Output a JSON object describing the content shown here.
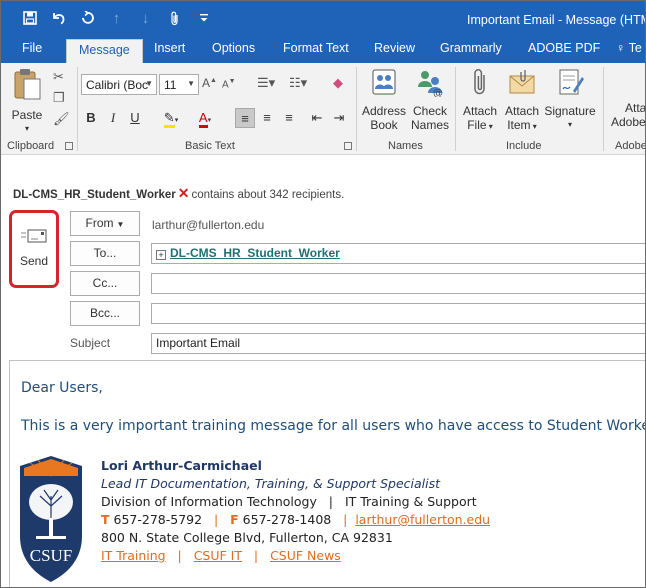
{
  "window": {
    "title": "Important Email - Message (HTM",
    "quick_access": [
      "save-icon",
      "undo-icon",
      "redo-icon",
      "up-arrow-icon",
      "down-arrow-icon",
      "attach-icon",
      "customize-icon"
    ]
  },
  "tabs": [
    {
      "label": "File",
      "active": false
    },
    {
      "label": "Message",
      "active": true
    },
    {
      "label": "Insert",
      "active": false
    },
    {
      "label": "Options",
      "active": false
    },
    {
      "label": "Format Text",
      "active": false
    },
    {
      "label": "Review",
      "active": false
    },
    {
      "label": "Grammarly",
      "active": false
    },
    {
      "label": "ADOBE PDF",
      "active": false
    },
    {
      "label": "Te",
      "active": false
    }
  ],
  "ribbon": {
    "clipboard": {
      "label": "Clipboard",
      "paste": "Paste"
    },
    "basic_text": {
      "label": "Basic Text",
      "font_name": "Calibri (Boc",
      "font_size": "11"
    },
    "names": {
      "label": "Names",
      "address_book": [
        "Address",
        "Book"
      ],
      "check_names": [
        "Check",
        "Names"
      ]
    },
    "include": {
      "label": "Include",
      "attach_file": [
        "Attach",
        "File"
      ],
      "attach_item": [
        "Attach",
        "Item"
      ],
      "signature": [
        "Signature",
        ""
      ]
    },
    "adobe": {
      "label": "Adobe",
      "attach": [
        "Atta",
        "Adobe"
      ]
    }
  },
  "info_bar": {
    "list_name": "DL-CMS_HR_Student_Worker",
    "message": "contains about 342 recipients."
  },
  "send": {
    "label": "Send"
  },
  "header": {
    "from_button": "From",
    "from_value": "larthur@fullerton.edu",
    "to_button": "To...",
    "to_value": "DL-CMS_HR_Student_Worker",
    "cc_button": "Cc...",
    "cc_value": "",
    "bcc_button": "Bcc...",
    "bcc_value": "",
    "subject_label": "Subject",
    "subject_value": "Important Email"
  },
  "body": {
    "greeting": "Dear Users,",
    "message": "This is a very important training message for all users who have access to Student Worker functionality."
  },
  "signature": {
    "name": "Lori Arthur-Carmichael",
    "title": "Lead IT Documentation, Training, & Support Specialist",
    "division": "Division of Information Technology",
    "separator": "|",
    "unit": "IT Training & Support",
    "phone_prefix": "T",
    "phone": "657-278-5792",
    "fax_prefix": "F",
    "fax": "657-278-1408",
    "email": "larthur@fullerton.edu",
    "address": "800 N. State College Blvd, Fullerton, CA 92831",
    "links": [
      "IT Training",
      "CSUF IT",
      "CSUF News"
    ],
    "logo_text": "CSUF"
  },
  "colors": {
    "titlebar": "#1f63b8",
    "ribbon": "#f2f2f2",
    "send_highlight": "#d9232b",
    "body_text": "#1f4e79",
    "sig_accent": "#e06c1f",
    "csuf_blue": "#1d3a6b"
  }
}
